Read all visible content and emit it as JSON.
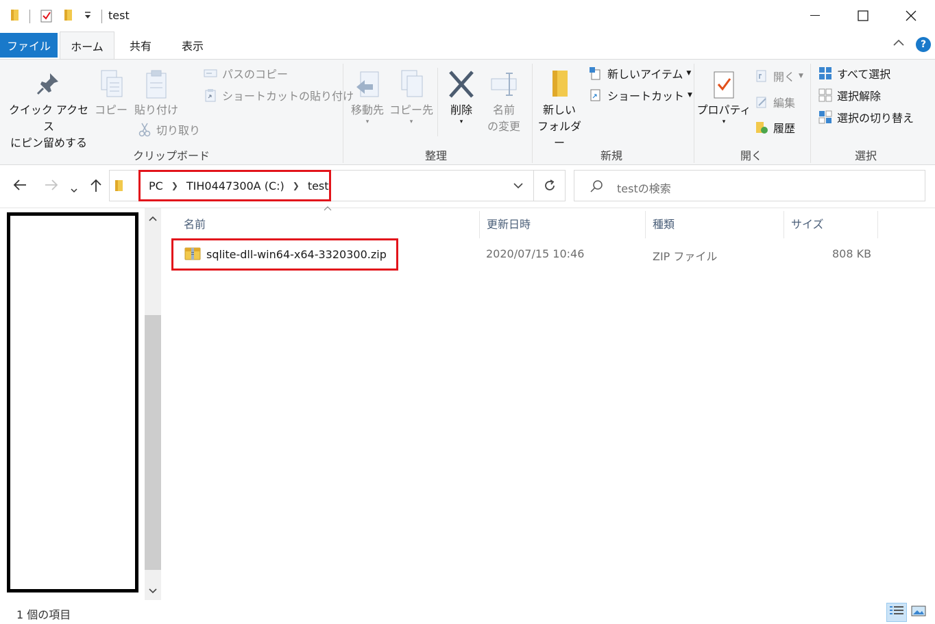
{
  "window": {
    "title": "test",
    "minimize_glyph": "—",
    "maximize_glyph": "☐",
    "close_glyph": "✕"
  },
  "tabs": {
    "file": "ファイル",
    "home": "ホーム",
    "share": "共有",
    "view": "表示",
    "help": "?"
  },
  "ribbon": {
    "clipboard": {
      "pin_line1": "クイック アクセス",
      "pin_line2": "にピン留めする",
      "copy": "コピー",
      "paste": "貼り付け",
      "copy_path": "パスのコピー",
      "paste_shortcut": "ショートカットの貼り付け",
      "cut": "切り取り",
      "label": "クリップボード"
    },
    "organize": {
      "move_to": "移動先",
      "copy_to": "コピー先",
      "delete": "削除",
      "rename_line1": "名前",
      "rename_line2": "の変更",
      "label": "整理"
    },
    "new": {
      "new_folder_line1": "新しい",
      "new_folder_line2": "フォルダー",
      "new_item": "新しいアイテム",
      "shortcut": "ショートカット",
      "label": "新規"
    },
    "open": {
      "properties": "プロパティ",
      "open": "開く",
      "edit": "編集",
      "history": "履歴",
      "label": "開く"
    },
    "select": {
      "select_all": "すべて選択",
      "select_none": "選択解除",
      "invert": "選択の切り替え",
      "label": "選択"
    }
  },
  "address": {
    "crumbs": [
      "PC",
      "TIH0447300A (C:)",
      "test"
    ],
    "search_placeholder": "testの検索"
  },
  "file_list": {
    "columns": [
      "名前",
      "更新日時",
      "種類",
      "サイズ"
    ],
    "rows": [
      {
        "name": "sqlite-dll-win64-x64-3320300.zip",
        "modified": "2020/07/15 10:46",
        "type": "ZIP ファイル",
        "size": "808 KB"
      }
    ]
  },
  "status": {
    "item_count": "1 個の項目"
  },
  "colors": {
    "accent": "#1979ca",
    "highlight_red": "#e2141b",
    "folder_yellow": "#f2c94c"
  }
}
